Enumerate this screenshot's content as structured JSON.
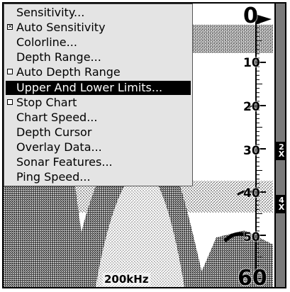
{
  "menu": {
    "items": [
      {
        "label": "Sensitivity...",
        "checkbox": null
      },
      {
        "label": "Auto Sensitivity",
        "checkbox": "checked"
      },
      {
        "label": "Colorline...",
        "checkbox": null
      },
      {
        "label": "Depth Range...",
        "checkbox": null
      },
      {
        "label": "Auto Depth Range",
        "checkbox": "unchecked"
      },
      {
        "label": "Upper And Lower Limits...",
        "checkbox": null,
        "selected": true
      },
      {
        "label": "Stop Chart",
        "checkbox": "unchecked"
      },
      {
        "label": "Chart Speed...",
        "checkbox": null
      },
      {
        "label": "Depth Cursor",
        "checkbox": null
      },
      {
        "label": "Overlay Data...",
        "checkbox": null
      },
      {
        "label": "Sonar Features...",
        "checkbox": null
      },
      {
        "label": "Ping Speed...",
        "checkbox": null
      }
    ]
  },
  "depth_scale": {
    "top": "0",
    "marks": [
      "10",
      "20",
      "30",
      "40",
      "50"
    ],
    "bottom": "60"
  },
  "frequency": "200kHz",
  "zoom": {
    "buttons": [
      {
        "label_top": "2",
        "label_bottom": "X"
      },
      {
        "label_top": "4",
        "label_bottom": "X"
      }
    ]
  },
  "colors": {
    "menu_bg": "#e4e4e4",
    "selected_bg": "#000000",
    "sonar_returns": "#1a1a1a",
    "zoom_bar": "#7a7a7a"
  }
}
